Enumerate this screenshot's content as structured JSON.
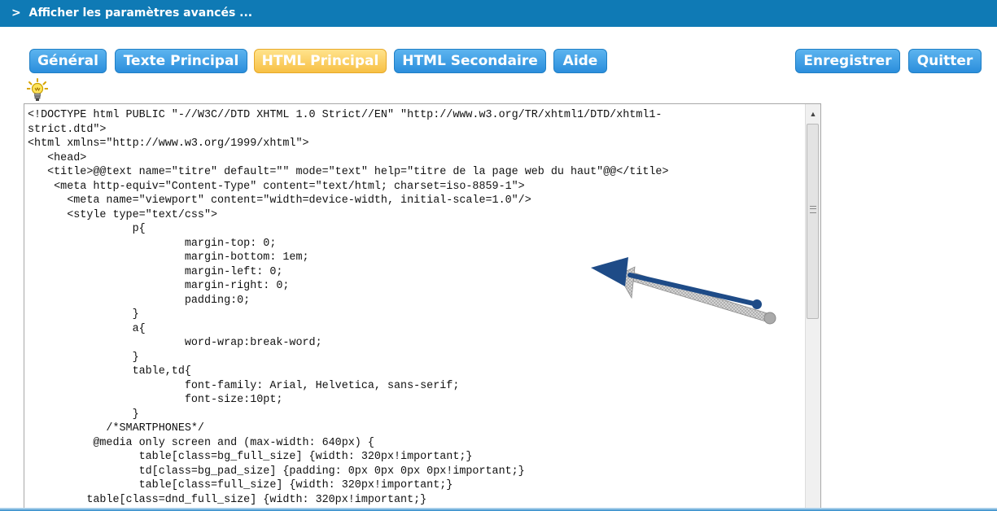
{
  "header": {
    "advanced_toggle": ">  Afficher les paramètres avancés ..."
  },
  "toolbar": {
    "general": "Général",
    "texte_principal": "Texte Principal",
    "html_principal": "HTML Principal",
    "html_secondaire": "HTML Secondaire",
    "aide": "Aide",
    "enregistrer": "Enregistrer",
    "quitter": "Quitter",
    "active_tab": "HTML Principal"
  },
  "editor": {
    "content": "<!DOCTYPE html PUBLIC \"-//W3C//DTD XHTML 1.0 Strict//EN\" \"http://www.w3.org/TR/xhtml1/DTD/xhtml1-\nstrict.dtd\">\n<html xmlns=\"http://www.w3.org/1999/xhtml\">\n   <head>\n   <title>@@text name=\"titre\" default=\"\" mode=\"text\" help=\"titre de la page web du haut\"@@</title>\n    <meta http-equiv=\"Content-Type\" content=\"text/html; charset=iso-8859-1\">\n      <meta name=\"viewport\" content=\"width=device-width, initial-scale=1.0\"/>\n      <style type=\"text/css\">\n                p{\n                        margin-top: 0;\n                        margin-bottom: 1em;\n                        margin-left: 0;\n                        margin-right: 0;\n                        padding:0;\n                }\n                a{\n                        word-wrap:break-word;\n                }\n                table,td{\n                        font-family: Arial, Helvetica, sans-serif;\n                        font-size:10pt;\n                }\n            /*SMARTPHONES*/\n          @media only screen and (max-width: 640px) {\n                 table[class=bg_full_size] {width: 320px!important;}\n                 td[class=bg_pad_size] {padding: 0px 0px 0px 0px!important;}\n                 table[class=full_size] {width: 320px!important;}\n         table[class=dnd_full_size] {width: 320px!important;}"
  },
  "colors": {
    "header_bg": "#0f7ab5",
    "button_blue": "#2b8edc",
    "button_active": "#f7c045",
    "arrow_blue": "#1e4b87"
  },
  "icons": {
    "bulb": "lightbulb-icon",
    "scroll_up": "scroll-up-arrow-icon",
    "arrow": "pointer-arrow-icon"
  }
}
